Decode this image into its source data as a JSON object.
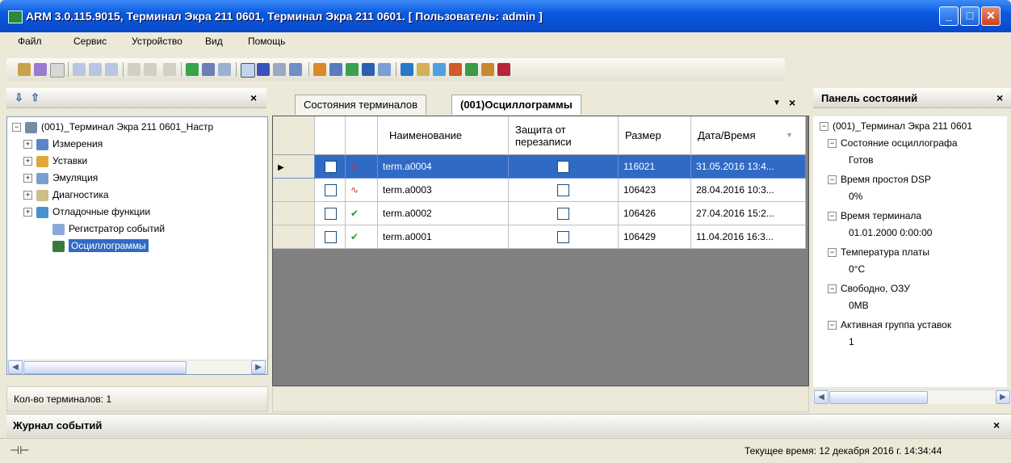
{
  "window": {
    "title": "ARM 3.0.115.9015, Терминал Экра 211 0601, Терминал Экра 211 0601. [ Пользователь: admin ]"
  },
  "menu": [
    "Файл",
    "Сервис",
    "Устройство",
    "Вид",
    "Помощь"
  ],
  "left_panel": {
    "tree": [
      {
        "label": "(001)_Терминал Экра 211 0601_Настр",
        "icon": "terminal-icon",
        "expander": "−"
      },
      {
        "label": "Измерения",
        "icon": "measurements-icon",
        "expander": "+"
      },
      {
        "label": "Уставки",
        "icon": "settings-folder-icon",
        "expander": "+"
      },
      {
        "label": "Эмуляция",
        "icon": "emulation-icon",
        "expander": "+"
      },
      {
        "label": "Диагностика",
        "icon": "diagnostics-icon",
        "expander": "+"
      },
      {
        "label": "Отладочные функции",
        "icon": "debug-icon",
        "expander": "+"
      },
      {
        "label": "Регистратор событий",
        "icon": "event-log-icon",
        "expander": ""
      },
      {
        "label": "Осциллограммы",
        "icon": "oscillogram-icon",
        "expander": ""
      }
    ],
    "footer": "Кол-во терминалов: 1"
  },
  "tabs": {
    "items": [
      "Состояния терминалов",
      "(001)Осциллограммы"
    ],
    "active": 1
  },
  "grid": {
    "columns": [
      "Наименование",
      "Защита от перезаписи",
      "Размер",
      "Дата/Время"
    ],
    "rows": [
      {
        "name": "term.a0004",
        "size": "116021",
        "datetime": "31.05.2016 13:4...",
        "selected": true
      },
      {
        "name": "term.a0003",
        "size": "106423",
        "datetime": "28.04.2016 10:3...",
        "selected": false
      },
      {
        "name": "term.a0002",
        "size": "106426",
        "datetime": "27.04.2016 15:2...",
        "selected": false
      },
      {
        "name": "term.a0001",
        "size": "106429",
        "datetime": "11.04.2016 16:3...",
        "selected": false
      }
    ]
  },
  "right_panel": {
    "title": "Панель состояний",
    "root": "(001)_Терминал Экра 211 0601",
    "items": [
      {
        "label": "Состояние осциллографа",
        "value": "Готов"
      },
      {
        "label": "Время простоя DSP",
        "value": "0%"
      },
      {
        "label": "Время терминала",
        "value": "01.01.2000 0:00:00"
      },
      {
        "label": "Температура платы",
        "value": "0°C"
      },
      {
        "label": "Свободно, ОЗУ",
        "value": "0MB"
      },
      {
        "label": "Активная группа уставок",
        "value": "1"
      }
    ]
  },
  "journal": {
    "title": "Журнал событий"
  },
  "status": {
    "time": "Текущее время: 12 декабря 2016 г. 14:34:44"
  }
}
